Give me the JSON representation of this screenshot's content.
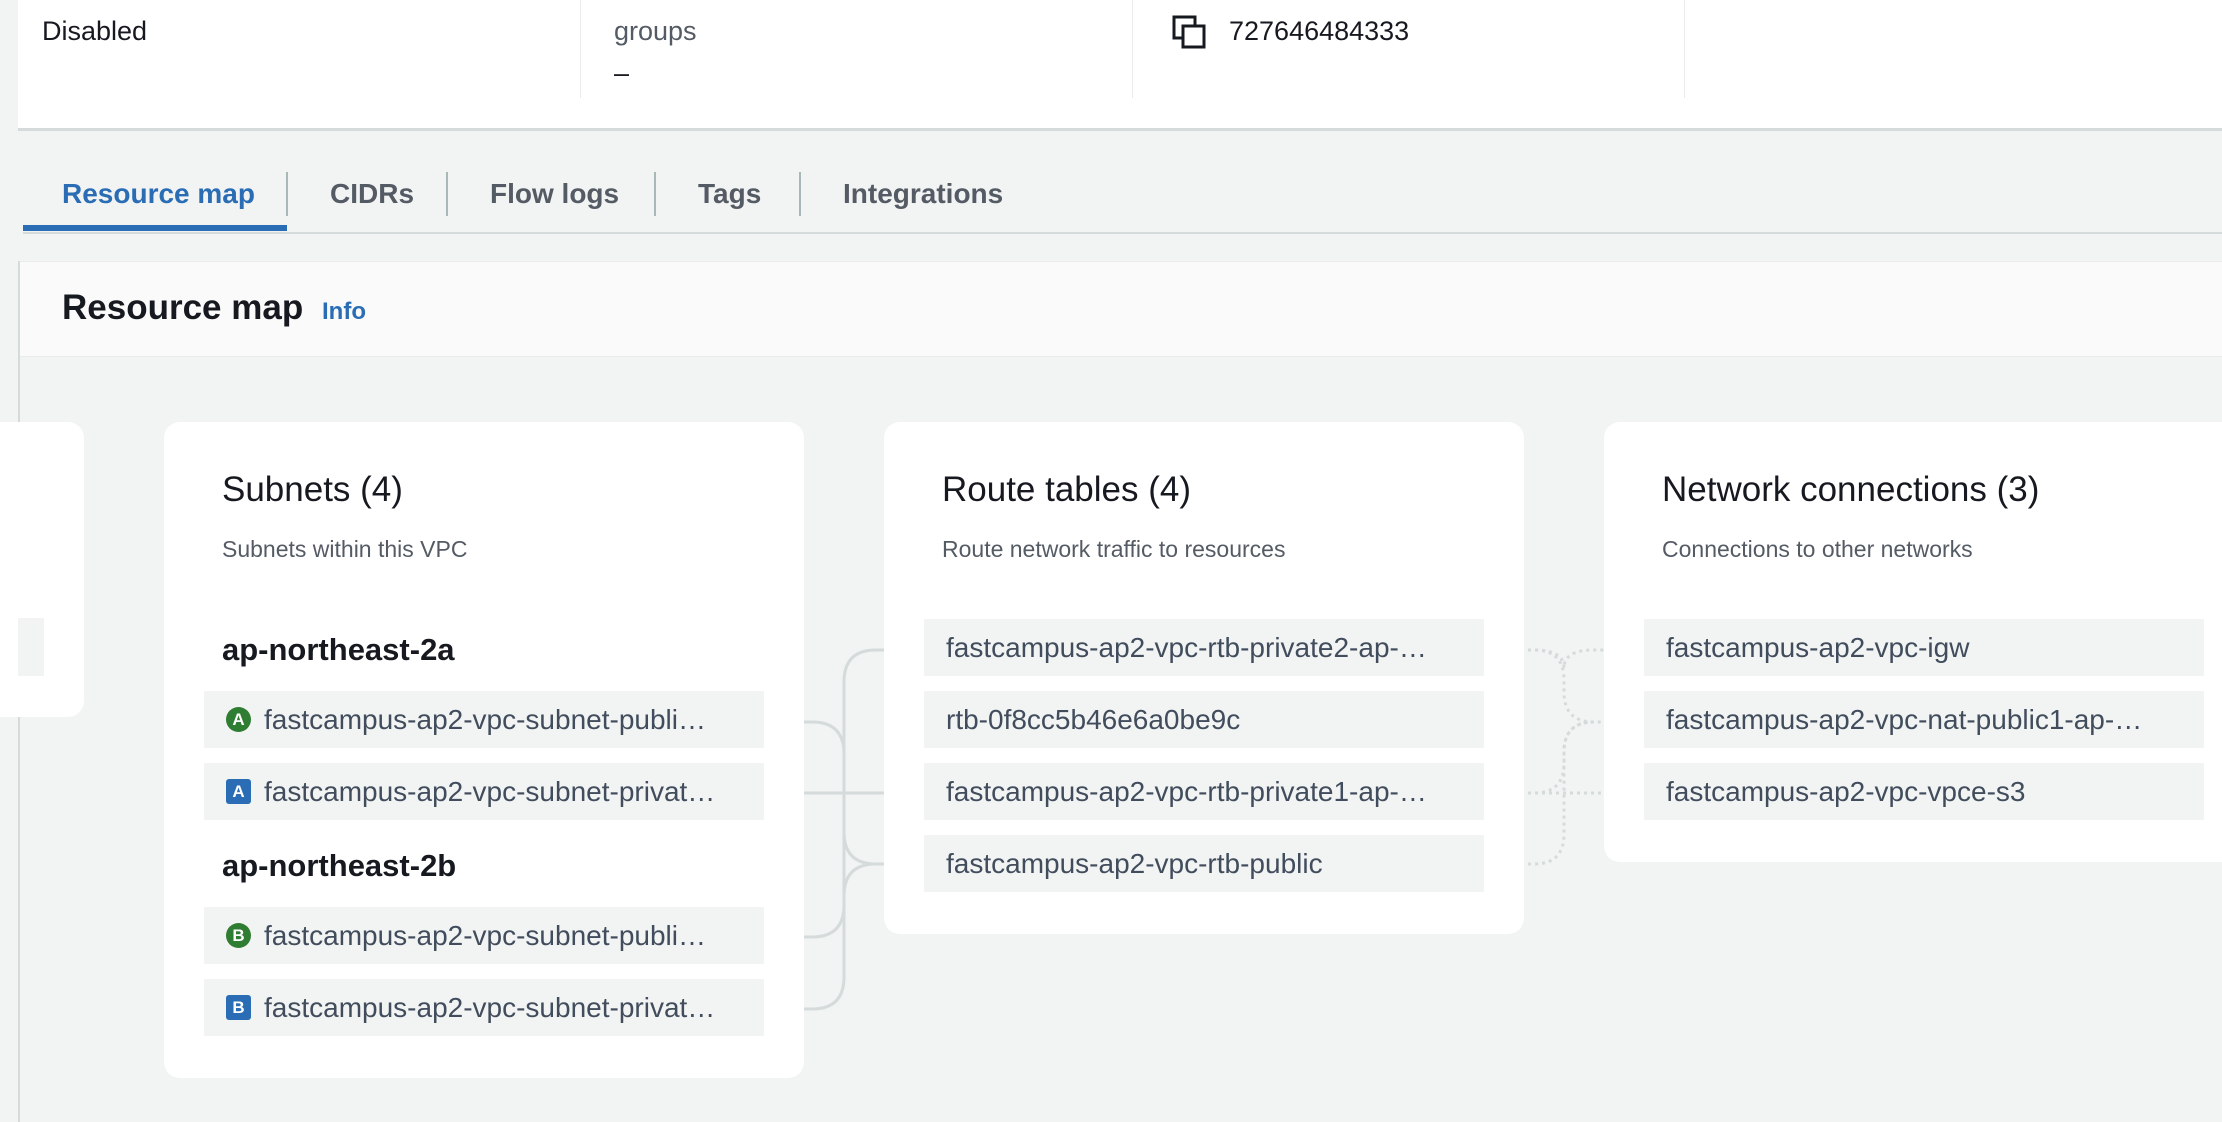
{
  "summary": {
    "status_value": "Disabled",
    "groups_label": "groups",
    "groups_value": "–",
    "copy_icon": "copy-icon",
    "account_id": "727646484333"
  },
  "tabs": [
    {
      "label": "Resource map",
      "active": true
    },
    {
      "label": "CIDRs",
      "active": false
    },
    {
      "label": "Flow logs",
      "active": false
    },
    {
      "label": "Tags",
      "active": false
    },
    {
      "label": "Integrations",
      "active": false
    }
  ],
  "resource_map": {
    "title": "Resource map",
    "info_link": "Info",
    "subnets": {
      "title": "Subnets (4)",
      "description": "Subnets within this VPC",
      "zones": [
        {
          "name": "ap-northeast-2a",
          "items": [
            {
              "badge": "A",
              "badge_type": "public",
              "label": "fastcampus-ap2-vpc-subnet-publi…"
            },
            {
              "badge": "A",
              "badge_type": "private",
              "label": "fastcampus-ap2-vpc-subnet-privat…"
            }
          ]
        },
        {
          "name": "ap-northeast-2b",
          "items": [
            {
              "badge": "B",
              "badge_type": "public",
              "label": "fastcampus-ap2-vpc-subnet-publi…"
            },
            {
              "badge": "B",
              "badge_type": "private",
              "label": "fastcampus-ap2-vpc-subnet-privat…"
            }
          ]
        }
      ]
    },
    "route_tables": {
      "title": "Route tables (4)",
      "description": "Route network traffic to resources",
      "items": [
        "fastcampus-ap2-vpc-rtb-private2-ap-…",
        "rtb-0f8cc5b46e6a0be9c",
        "fastcampus-ap2-vpc-rtb-private1-ap-…",
        "fastcampus-ap2-vpc-rtb-public"
      ]
    },
    "network_connections": {
      "title": "Network connections (3)",
      "description": "Connections to other networks",
      "items": [
        "fastcampus-ap2-vpc-igw",
        "fastcampus-ap2-vpc-nat-public1-ap-…",
        "fastcampus-ap2-vpc-vpce-s3"
      ]
    }
  },
  "colors": {
    "accent": "#2a6db5",
    "public_badge": "#2e7d32",
    "private_badge": "#2a6db5",
    "background": "#f2f3f3"
  }
}
